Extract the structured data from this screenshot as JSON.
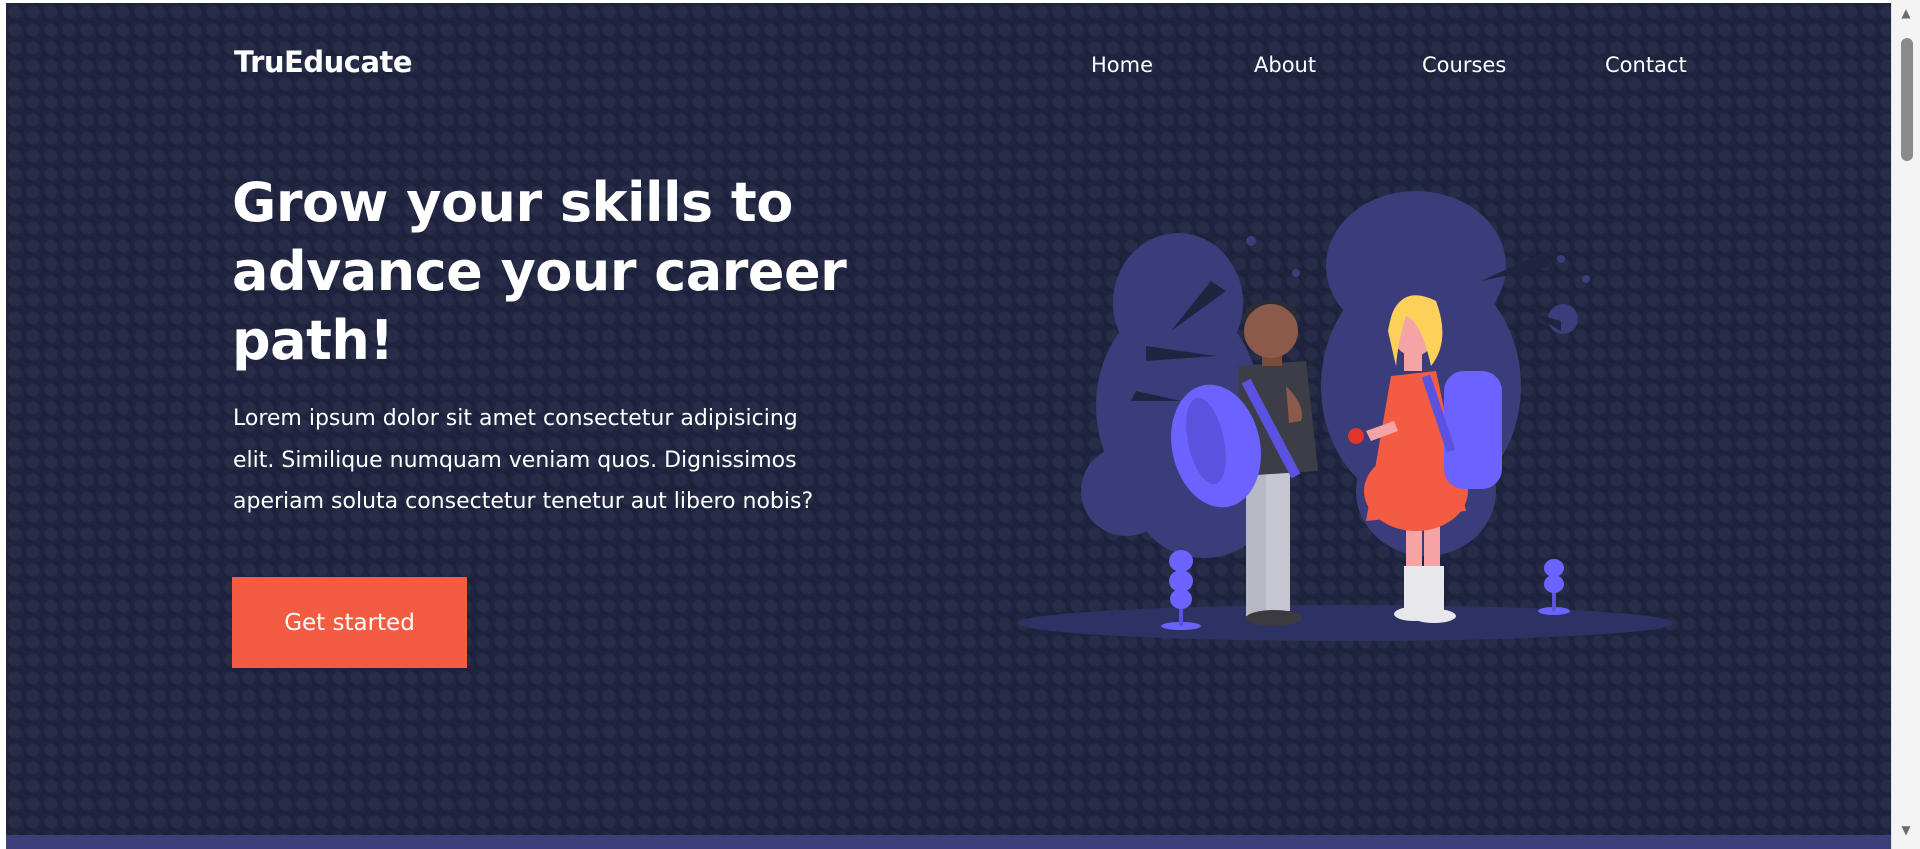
{
  "brand": {
    "name": "TruEducate"
  },
  "nav": {
    "home": "Home",
    "about": "About",
    "courses": "Courses",
    "contact": "Contact"
  },
  "hero": {
    "title_line1": "Grow your skills to",
    "title_line2": "advance your career",
    "title_line3": "path!",
    "text_line1": "Lorem ipsum dolor sit amet consectetur adipisicing",
    "text_line2": "elit. Similique numquam veniam quos. Dignissimos",
    "text_line3": "aperiam soluta consectetur tenetur aut libero nobis?",
    "cta_label": "Get started"
  },
  "illustration": {
    "icon": "students-with-backpacks-illustration"
  },
  "scrollbar": {
    "up_icon": "chevron-up-icon",
    "down_icon": "chevron-down-icon"
  },
  "colors": {
    "background": "#1f2540",
    "accent": "#f45b43",
    "illustration_purple": "#6c63ff",
    "blob": "#3b3d7a"
  }
}
